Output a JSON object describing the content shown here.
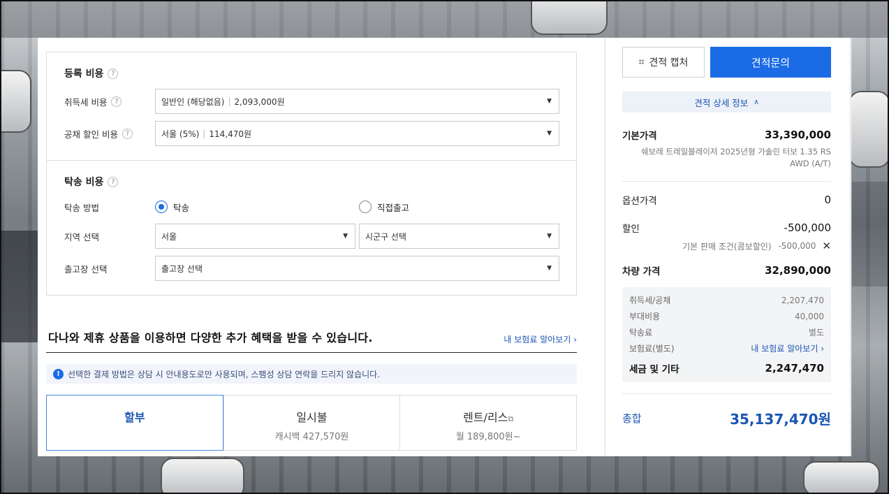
{
  "registration": {
    "title": "등록 비용",
    "help": "?",
    "acquisition_tax": {
      "label": "취득세 비용",
      "option": "일반인 (해당없음)",
      "amount": "2,093,000원"
    },
    "bond_discount": {
      "label": "공채 할인 비용",
      "option": "서울 (5%)",
      "amount": "114,470원"
    }
  },
  "delivery": {
    "title": "탁송 비용",
    "help": "?",
    "method_label": "탁송 방법",
    "methods": [
      "탁송",
      "직접출고"
    ],
    "selected_method": "탁송",
    "region_label": "지역 선택",
    "region_value": "서울",
    "district_value": "시군구 선택",
    "depot_label": "출고장 선택",
    "depot_value": "출고장 선택"
  },
  "promo": {
    "headline": "다나와 제휴 상품을 이용하면 다양한 추가 혜택을 받을 수 있습니다.",
    "insurance_link": "내 보험료 알아보기",
    "notice": "선택한 결제 방법은 상담 시 안내용도로만 사용되며, 스팸성 상담 연락을 드리지 않습니다.",
    "tabs": [
      {
        "title": "할부",
        "sub": ""
      },
      {
        "title": "일시불",
        "sub": "캐시백 427,570원"
      },
      {
        "title": "렌트/리스",
        "sub": "월 189,800원~"
      }
    ]
  },
  "summary": {
    "capture_button": "견적 캡처",
    "inquiry_button": "견적문의",
    "detail_toggle": "견적 상세 정보",
    "base_price_label": "기본가격",
    "base_price": "33,390,000",
    "model_desc": "쉐보레 트레일블레이저 2025년형 가솔린 터보 1.35 RS AWD (A/T)",
    "option_label": "옵션가격",
    "option_price": "0",
    "discount_label": "할인",
    "discount": "-500,000",
    "discount_item": "기본 판매 조건(콤보할인)",
    "discount_item_amount": "-500,000",
    "vehicle_price_label": "차량 가격",
    "vehicle_price": "32,890,000",
    "tax_rows": [
      {
        "k": "취득세/공채",
        "v": "2,207,470"
      },
      {
        "k": "부대비용",
        "v": "40,000"
      },
      {
        "k": "탁송료",
        "v": "별도"
      },
      {
        "k": "보험료(별도)",
        "v": "내 보험료 알아보기"
      }
    ],
    "tax_total_label": "세금 및 기타",
    "tax_total": "2,247,470",
    "total_label": "총합",
    "total": "35,137,470원"
  },
  "colors": {
    "accent": "#1a6be5",
    "link": "#1a55b3"
  }
}
